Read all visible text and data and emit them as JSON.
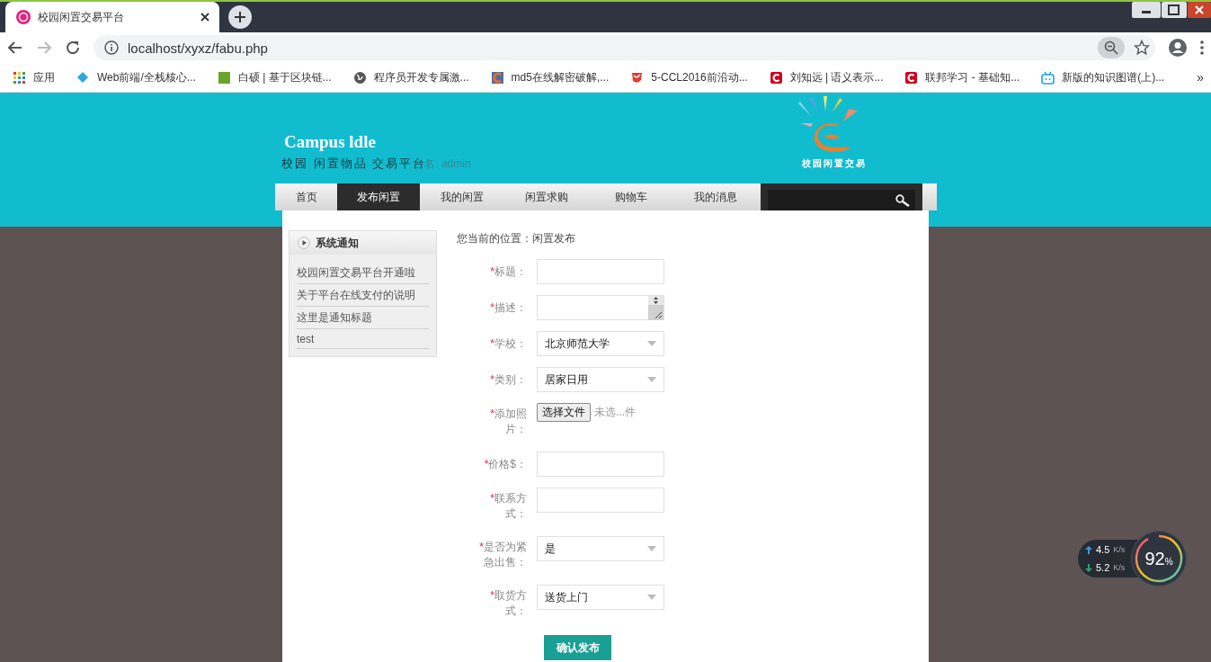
{
  "browser": {
    "tab_title": "校园闲置交易平台",
    "url": "localhost/xyxz/fabu.php",
    "bookmarks": [
      {
        "label": "应用",
        "kind": "apps"
      },
      {
        "label": "Web前端/全栈核心...",
        "kind": "diamond"
      },
      {
        "label": "白硕 | 基于区块链...",
        "kind": "green"
      },
      {
        "label": "程序员开发专属激...",
        "kind": "globe"
      },
      {
        "label": "md5在线解密破解,...",
        "kind": "orange"
      },
      {
        "label": "5-CCL2016前沿动...",
        "kind": "redswirl"
      },
      {
        "label": "刘知远 | 语义表示...",
        "kind": "redc"
      },
      {
        "label": "联邦学习 - 基础知...",
        "kind": "redc"
      },
      {
        "label": "新版的知识图谱(上)...",
        "kind": "tv"
      }
    ],
    "more": "»"
  },
  "header": {
    "title": "Campus ldle",
    "subtitle": "校园 闲置物品 交易平台",
    "user": "名: admin",
    "emblem_caption": "校园闲置交易"
  },
  "nav": [
    {
      "label": "首页",
      "selected": false
    },
    {
      "label": "发布闲置",
      "selected": true
    },
    {
      "label": "我的闲置",
      "selected": false
    },
    {
      "label": "闲置求购",
      "selected": false
    },
    {
      "label": "购物车",
      "selected": false
    },
    {
      "label": "我的消息",
      "selected": false
    }
  ],
  "notice": {
    "title": "系统通知",
    "items": [
      "校园闲置交易平台开通啦",
      "关于平台在线支付的说明",
      "这里是通知标题",
      "test"
    ]
  },
  "breadcrumb": "您当前的位置：闲置发布",
  "form": {
    "required_mark": "*",
    "fields": [
      {
        "label": "标题：",
        "kind": "text"
      },
      {
        "label": "描述：",
        "kind": "textarea"
      },
      {
        "label": "学校：",
        "kind": "select",
        "value": "北京师范大学"
      },
      {
        "label": "类别：",
        "kind": "select",
        "value": "居家日用"
      },
      {
        "label": "添加照片：",
        "kind": "file",
        "button": "选择文件",
        "value": "未选...件"
      },
      {
        "label": "价格$：",
        "kind": "text"
      },
      {
        "label": "联系方式：",
        "kind": "text"
      },
      {
        "label": "是否为紧急出售：",
        "kind": "select",
        "value": "是"
      },
      {
        "label": "取货方式：",
        "kind": "select",
        "value": "送货上门"
      }
    ],
    "submit": "确认发布"
  },
  "speed": {
    "up": "4.5",
    "up_unit": "K/s",
    "down": "5.2",
    "down_unit": "K/s",
    "usage": "92",
    "usage_unit": "%",
    "level": 0.92
  }
}
